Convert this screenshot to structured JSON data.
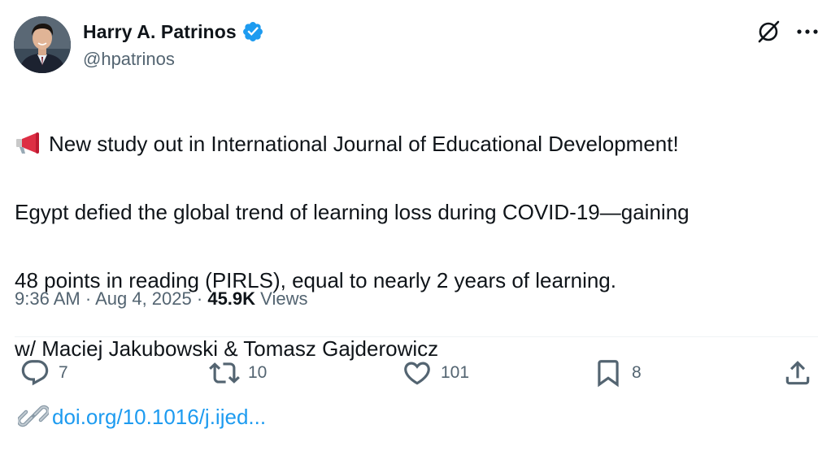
{
  "author": {
    "display_name": "Harry A. Patrinos",
    "handle": "@hpatrinos",
    "verified": true
  },
  "tweet": {
    "lines": [
      "New study out in International Journal of Educational Development!",
      "Egypt defied the global trend of learning loss during COVID-19—gaining",
      "48 points in reading (PIRLS), equal to nearly 2 years of learning.",
      "w/ Maciej Jakubowski & Tomasz Gajderowicz"
    ],
    "link_text": "doi.org/10.1016/j.ijed..."
  },
  "meta": {
    "time": "9:36 AM",
    "separator": "·",
    "date": "Aug 4, 2025",
    "views_count": "45.9K",
    "views_label": "Views"
  },
  "actions": {
    "replies": "7",
    "reposts": "10",
    "likes": "101",
    "bookmarks": "8"
  },
  "icons": {
    "verified": "verified-badge-icon",
    "grok": "grok-icon",
    "more": "more-icon",
    "megaphone": "megaphone-icon",
    "link": "link-icon",
    "reply": "reply-icon",
    "repost": "repost-icon",
    "like": "heart-icon",
    "bookmark": "bookmark-icon",
    "share": "share-icon"
  },
  "colors": {
    "text": "#0f1419",
    "secondary": "#536471",
    "link": "#1d9bf0",
    "verified": "#1d9bf0",
    "divider": "#eff3f4"
  }
}
